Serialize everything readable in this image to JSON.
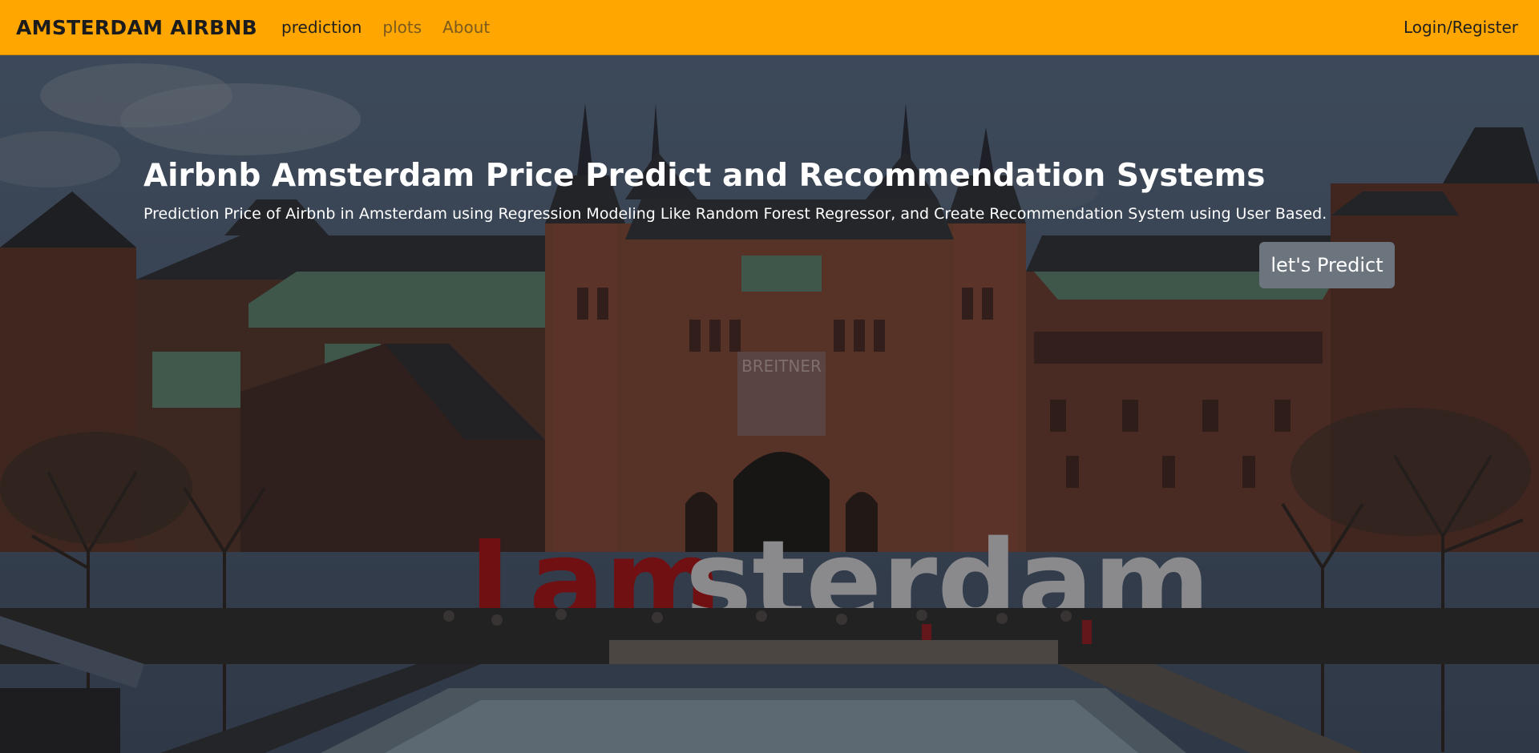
{
  "navbar": {
    "brand": "AMSTERDAM AIRBNB",
    "links": [
      {
        "label": "prediction",
        "state": "active"
      },
      {
        "label": "plots",
        "state": "inactive"
      },
      {
        "label": "About",
        "state": "inactive"
      }
    ],
    "login_label": "Login/Register",
    "background_color": "#ffa700"
  },
  "hero": {
    "title": "Airbnb Amsterdam Price Predict and Recommendation Systems",
    "subtitle": "Prediction Price of Airbnb in Amsterdam using Regression Modeling Like Random Forest Regressor, and Create Recommendation System using User Based.",
    "cta_label": "let's Predict",
    "cta_color": "#6c757d",
    "background_photo": {
      "subject": "Rijksmuseum with I amsterdam letters and ice rink",
      "sign_text": "I amsterdam",
      "banner_text": "BREITNER"
    }
  }
}
